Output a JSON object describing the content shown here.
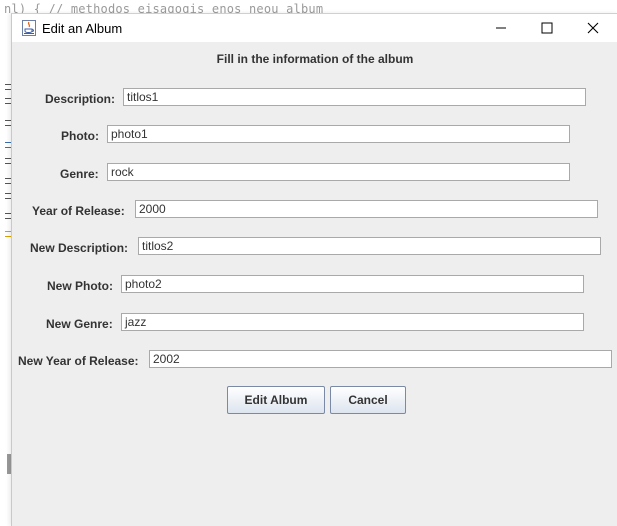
{
  "background": {
    "code_snippet": "nl) { // methodos eisagogis enos neou album"
  },
  "window": {
    "title": "Edit an Album"
  },
  "form": {
    "heading": "Fill in the information of the album",
    "fields": [
      {
        "label": "Description:",
        "value": "titlos1"
      },
      {
        "label": "Photo:",
        "value": "photo1"
      },
      {
        "label": "Genre:",
        "value": "rock"
      },
      {
        "label": "Year of Release:",
        "value": "2000"
      },
      {
        "label": "New Description:",
        "value": "titlos2"
      },
      {
        "label": "New Photo:",
        "value": "photo2"
      },
      {
        "label": "New Genre:",
        "value": "jazz"
      },
      {
        "label": "New Year of Release:",
        "value": "2002"
      }
    ]
  },
  "buttons": {
    "edit_label": "Edit Album",
    "cancel_label": "Cancel"
  },
  "icons": {
    "window": "java-coffee-cup-icon",
    "minimize": "minimize-icon",
    "maximize": "maximize-icon",
    "close": "close-icon"
  }
}
